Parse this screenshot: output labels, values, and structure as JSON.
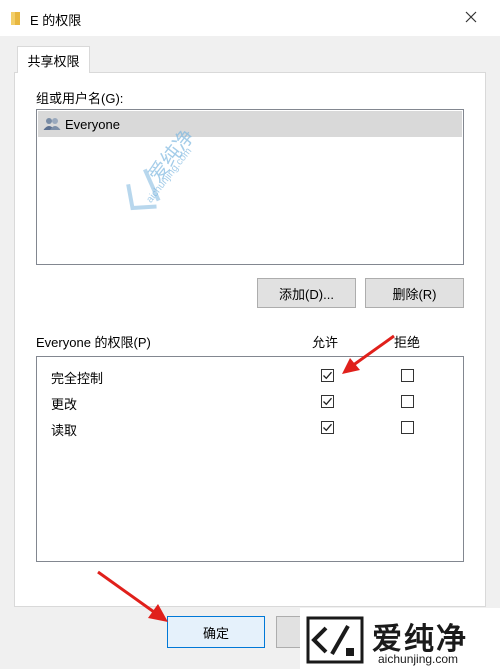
{
  "window": {
    "title": "E 的权限",
    "close_label": "✕"
  },
  "tabs": [
    {
      "label": "共享权限"
    }
  ],
  "groups": {
    "label": "组或用户名(G):",
    "items": [
      {
        "name": "Everyone",
        "selected": true
      }
    ]
  },
  "buttons": {
    "add_label": "添加(D)...",
    "remove_label": "删除(R)",
    "ok_label": "确定"
  },
  "permissions": {
    "title": "Everyone 的权限(P)",
    "allow_header": "允许",
    "deny_header": "拒绝",
    "rows": [
      {
        "name": "完全控制",
        "allow": true,
        "deny": false
      },
      {
        "name": "更改",
        "allow": true,
        "deny": false
      },
      {
        "name": "读取",
        "allow": true,
        "deny": false
      }
    ]
  },
  "watermark": {
    "brand_cn": "爱纯净",
    "brand_url": "aichunjing.com"
  },
  "colors": {
    "annotation_arrow": "#e0201b",
    "logo_dark": "#1a1a1a",
    "watermark": "#7fb8e0"
  }
}
